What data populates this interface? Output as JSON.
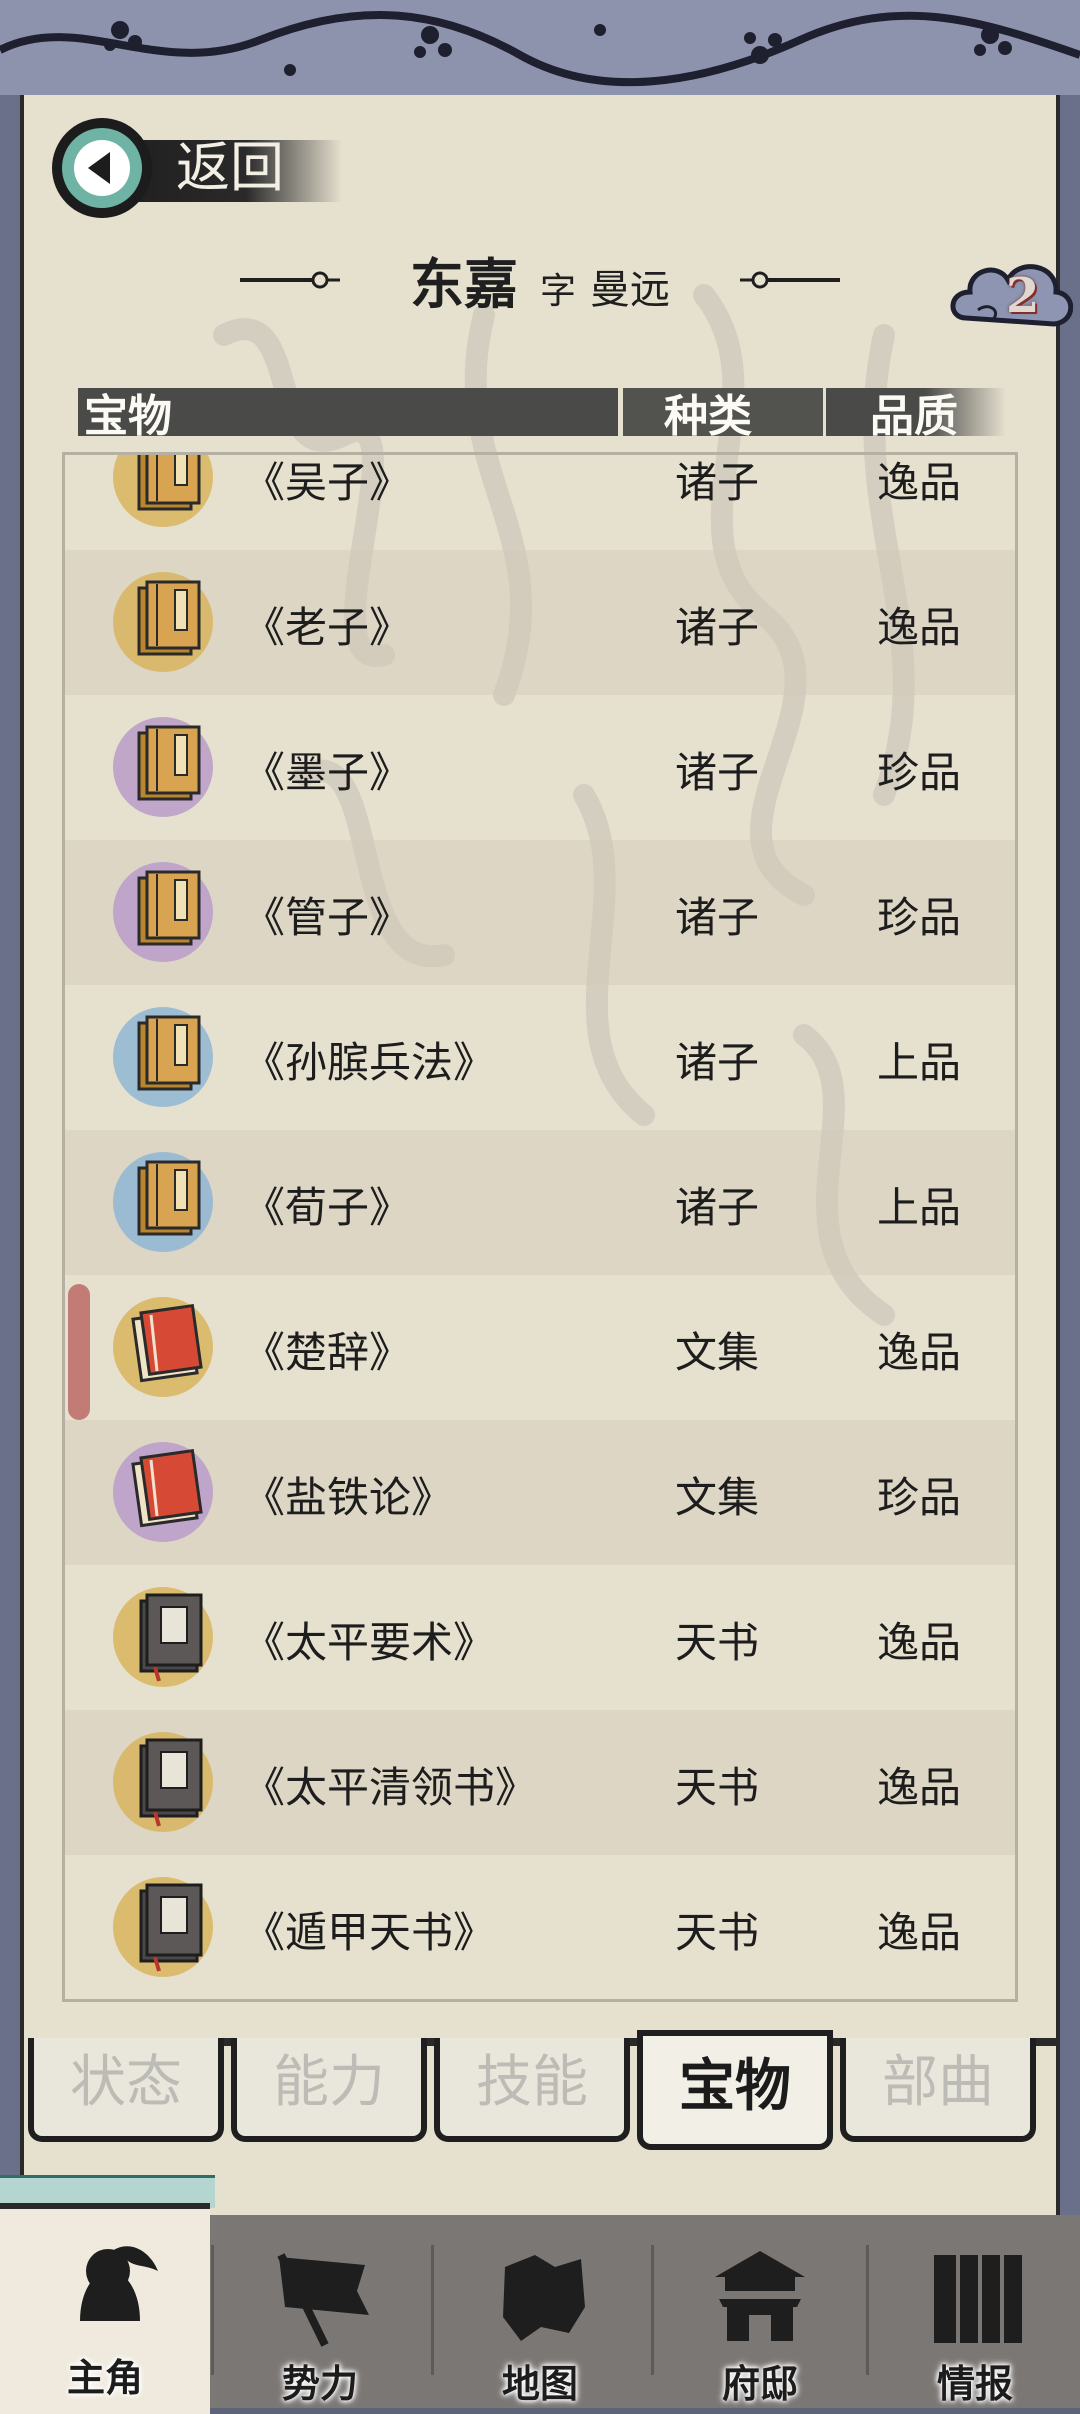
{
  "header": {
    "back_label": "返回",
    "name": "东嘉",
    "zi_label": "字",
    "style_name": "曼远",
    "badge": "2"
  },
  "table": {
    "columns": [
      "宝物",
      "种类",
      "品质"
    ],
    "rows": [
      {
        "name": "《吴子》",
        "type": "诸子",
        "quality": "逸品",
        "book": "bamboo",
        "halo": "#d8b45d"
      },
      {
        "name": "《老子》",
        "type": "诸子",
        "quality": "逸品",
        "book": "bamboo",
        "halo": "#d8b45d"
      },
      {
        "name": "《墨子》",
        "type": "诸子",
        "quality": "珍品",
        "book": "bamboo",
        "halo": "#b99cc9"
      },
      {
        "name": "《管子》",
        "type": "诸子",
        "quality": "珍品",
        "book": "bamboo",
        "halo": "#b99cc9"
      },
      {
        "name": "《孙膑兵法》",
        "type": "诸子",
        "quality": "上品",
        "book": "bamboo",
        "halo": "#8fb6d3"
      },
      {
        "name": "《荀子》",
        "type": "诸子",
        "quality": "上品",
        "book": "bamboo",
        "halo": "#8fb6d3"
      },
      {
        "name": "《楚辞》",
        "type": "文集",
        "quality": "逸品",
        "book": "red",
        "halo": "#d8b45d"
      },
      {
        "name": "《盐铁论》",
        "type": "文集",
        "quality": "珍品",
        "book": "red",
        "halo": "#b99cc9"
      },
      {
        "name": "《太平要术》",
        "type": "天书",
        "quality": "逸品",
        "book": "dark",
        "halo": "#d8b45d"
      },
      {
        "name": "《太平清领书》",
        "type": "天书",
        "quality": "逸品",
        "book": "dark",
        "halo": "#d8b45d"
      },
      {
        "name": "《遁甲天书》",
        "type": "天书",
        "quality": "逸品",
        "book": "dark",
        "halo": "#d8b45d"
      }
    ]
  },
  "tabs": [
    {
      "label": "状态",
      "active": false
    },
    {
      "label": "能力",
      "active": false
    },
    {
      "label": "技能",
      "active": false
    },
    {
      "label": "宝物",
      "active": true
    },
    {
      "label": "部曲",
      "active": false
    }
  ],
  "nav": [
    {
      "label": "主角",
      "icon": "hero-icon",
      "active": true
    },
    {
      "label": "势力",
      "icon": "flag-icon",
      "active": false
    },
    {
      "label": "地图",
      "icon": "map-icon",
      "active": false
    },
    {
      "label": "府邸",
      "icon": "mansion-icon",
      "active": false
    },
    {
      "label": "情报",
      "icon": "scroll-icon",
      "active": false
    }
  ]
}
